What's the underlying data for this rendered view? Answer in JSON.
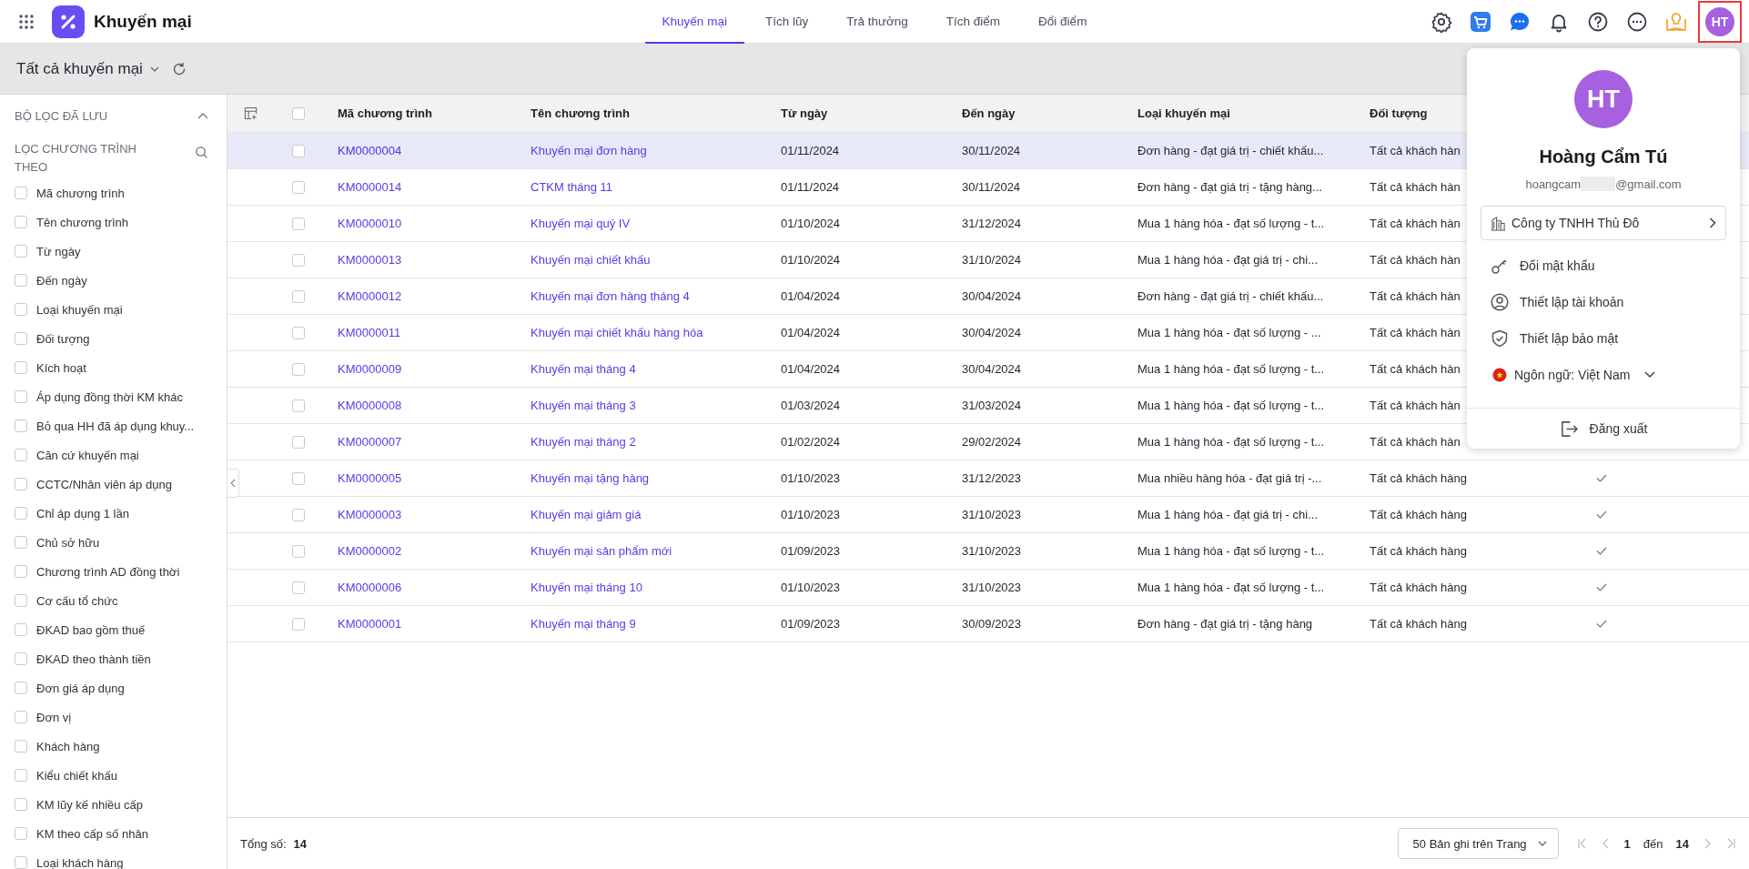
{
  "app": {
    "title": "Khuyến mại"
  },
  "tabs": [
    {
      "label": "Khuyến mại",
      "selected": true
    },
    {
      "label": "Tích lũy",
      "selected": false
    },
    {
      "label": "Trả thưởng",
      "selected": false
    },
    {
      "label": "Tích điểm",
      "selected": false
    },
    {
      "label": "Đổi điểm",
      "selected": false
    }
  ],
  "avatar": {
    "initials": "HT"
  },
  "toolbar": {
    "view_title": "Tất cả khuyến mại"
  },
  "sidebar": {
    "saved_filters_title": "BỘ LỌC ĐÃ LƯU",
    "filter_title": "LỌC CHƯƠNG TRÌNH THEO",
    "filters": [
      {
        "label": "Mã chương trình",
        "checked": false
      },
      {
        "label": "Tên chương trình",
        "checked": false
      },
      {
        "label": "Từ ngày",
        "checked": false
      },
      {
        "label": "Đến ngày",
        "checked": false
      },
      {
        "label": "Loại khuyến mại",
        "checked": false
      },
      {
        "label": "Đối tượng",
        "checked": false
      },
      {
        "label": "Kích hoạt",
        "checked": false
      },
      {
        "label": "Áp dụng đồng thời KM khác",
        "checked": false
      },
      {
        "label": "Bỏ qua HH đã áp dụng khuy...",
        "checked": false
      },
      {
        "label": "Căn cứ khuyến mại",
        "checked": false
      },
      {
        "label": "CCTC/Nhân viên áp dụng",
        "checked": false
      },
      {
        "label": "Chỉ áp dụng 1 lần",
        "checked": false
      },
      {
        "label": "Chủ sở hữu",
        "checked": false
      },
      {
        "label": "Chương trình AD đồng thời",
        "checked": false
      },
      {
        "label": "Cơ cấu tổ chức",
        "checked": false
      },
      {
        "label": "ĐKAD bao gồm thuế",
        "checked": false
      },
      {
        "label": "ĐKAD theo thành tiền",
        "checked": false
      },
      {
        "label": "Đơn giá áp dụng",
        "checked": false
      },
      {
        "label": "Đơn vị",
        "checked": false
      },
      {
        "label": "Khách hàng",
        "checked": false
      },
      {
        "label": "Kiểu chiết khấu",
        "checked": false
      },
      {
        "label": "KM lũy kế nhiều cấp",
        "checked": false
      },
      {
        "label": "KM theo cấp số nhân",
        "checked": false
      },
      {
        "label": "Loại khách hàng",
        "checked": false
      }
    ]
  },
  "table": {
    "all_checked": false,
    "columns": [
      "Mã chương trình",
      "Tên chương trình",
      "Từ ngày",
      "Đến ngày",
      "Loại khuyến mại",
      "Đối tượng"
    ],
    "rows": [
      {
        "code": "KM0000004",
        "name": "Khuyến mại đơn hàng",
        "from": "01/11/2024",
        "to": "30/11/2024",
        "type": "Đơn hàng - đạt giá trị - chiết khấu...",
        "target": "Tất cả khách hàn",
        "selected": true,
        "checked": false
      },
      {
        "code": "KM0000014",
        "name": "CTKM tháng 11",
        "from": "01/11/2024",
        "to": "30/11/2024",
        "type": "Đơn hàng - đạt giá trị - tặng hàng...",
        "target": "Tất cả khách hàn",
        "selected": false,
        "checked": false
      },
      {
        "code": "KM0000010",
        "name": "Khuyến mại quý IV",
        "from": "01/10/2024",
        "to": "31/12/2024",
        "type": "Mua 1 hàng hóa - đạt số lượng - t...",
        "target": "Tất cả khách hàn",
        "selected": false,
        "checked": false
      },
      {
        "code": "KM0000013",
        "name": "Khuyến mại chiết khấu",
        "from": "01/10/2024",
        "to": "31/10/2024",
        "type": "Mua 1 hàng hóa - đạt giá trị - chi...",
        "target": "Tất cả khách hàn",
        "selected": false,
        "checked": false
      },
      {
        "code": "KM0000012",
        "name": "Khuyến mại đơn hàng tháng 4",
        "from": "01/04/2024",
        "to": "30/04/2024",
        "type": "Đơn hàng - đạt giá trị - chiết khấu...",
        "target": "Tất cả khách hàn",
        "selected": false,
        "checked": false
      },
      {
        "code": "KM0000011",
        "name": "Khuyến mại chiết khấu hàng hóa",
        "from": "01/04/2024",
        "to": "30/04/2024",
        "type": "Mua 1 hàng hóa - đạt số lượng - ...",
        "target": "Tất cả khách hàn",
        "selected": false,
        "checked": false
      },
      {
        "code": "KM0000009",
        "name": "Khuyến mại tháng 4",
        "from": "01/04/2024",
        "to": "30/04/2024",
        "type": "Mua 1 hàng hóa - đạt số lượng - t...",
        "target": "Tất cả khách hàn",
        "selected": false,
        "checked": false
      },
      {
        "code": "KM0000008",
        "name": "Khuyến mại tháng 3",
        "from": "01/03/2024",
        "to": "31/03/2024",
        "type": "Mua 1 hàng hóa - đạt số lượng - t...",
        "target": "Tất cả khách hàn",
        "selected": false,
        "checked": false
      },
      {
        "code": "KM0000007",
        "name": "Khuyến mại tháng 2",
        "from": "01/02/2024",
        "to": "29/02/2024",
        "type": "Mua 1 hàng hóa - đạt số lượng - t...",
        "target": "Tất cả khách hàn",
        "selected": false,
        "checked": false
      },
      {
        "code": "KM0000005",
        "name": "Khuyến mại tặng hàng",
        "from": "01/10/2023",
        "to": "31/12/2023",
        "type": "Mua nhiều hàng hóa - đạt giá trị -...",
        "target": "Tất cả khách hàng",
        "selected": false,
        "checked": false,
        "active": true
      },
      {
        "code": "KM0000003",
        "name": "Khuyến mại giảm giá",
        "from": "01/10/2023",
        "to": "31/10/2023",
        "type": "Mua 1 hàng hóa - đạt giá trị - chi...",
        "target": "Tất cả khách hàng",
        "selected": false,
        "checked": false,
        "active": true
      },
      {
        "code": "KM0000002",
        "name": "Khuyến mại sản phẩm mới",
        "from": "01/09/2023",
        "to": "31/10/2023",
        "type": "Mua 1 hàng hóa - đạt số lượng - t...",
        "target": "Tất cả khách hàng",
        "selected": false,
        "checked": false,
        "active": true
      },
      {
        "code": "KM0000006",
        "name": "Khuyến mại tháng 10",
        "from": "01/10/2023",
        "to": "31/10/2023",
        "type": "Mua 1 hàng hóa - đạt số lượng - t...",
        "target": "Tất cả khách hàng",
        "selected": false,
        "checked": false,
        "active": true
      },
      {
        "code": "KM0000001",
        "name": "Khuyến mại tháng 9",
        "from": "01/09/2023",
        "to": "30/09/2023",
        "type": "Đơn hàng - đạt giá trị - tặng hàng",
        "target": "Tất cả khách hàng",
        "selected": false,
        "checked": false,
        "active": true
      }
    ]
  },
  "footer": {
    "total_label": "Tổng số:",
    "total": "14",
    "page_size": "50 Bản ghi trên Trang",
    "page": "1",
    "page_sep": "đến",
    "pages": "14"
  },
  "user_menu": {
    "initials": "HT",
    "name": "Hoàng Cẩm Tú",
    "email_start": "hoangcam",
    "email_end": "@gmail.com",
    "company": "Công ty TNHH Thủ Đô",
    "items": [
      {
        "kind": "key",
        "label": "Đổi mật khẩu"
      },
      {
        "kind": "user",
        "label": "Thiết lập tài khoản"
      },
      {
        "kind": "shield",
        "label": "Thiết lập bảo mật"
      }
    ],
    "language": "Ngôn ngữ: Việt Nam",
    "logout": "Đăng xuất"
  }
}
